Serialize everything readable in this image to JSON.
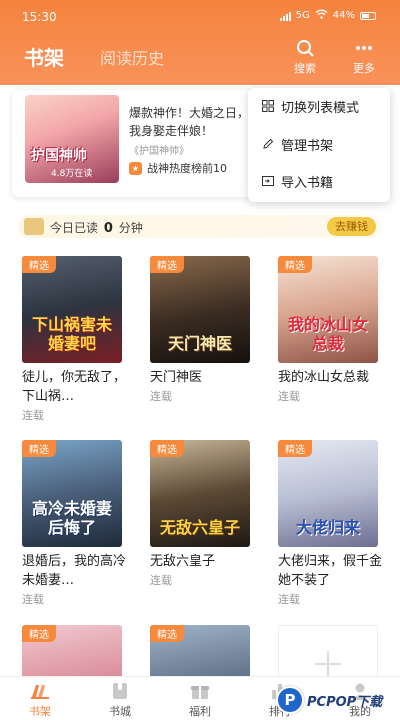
{
  "status_bar": {
    "time": "15:30",
    "network": "5G",
    "battery": "44%"
  },
  "header": {
    "tabs": [
      {
        "label": "书架"
      },
      {
        "label": "阅读历史"
      }
    ],
    "search_label": "搜索",
    "more_label": "更多"
  },
  "featured": {
    "cover_title": "护国神帅",
    "cover_readers": "4.8万在读",
    "description": "爆款神作！大婚之日，而我身娶走伴娘！",
    "book_name": "《护国神帅》",
    "rank_text": "战神热度榜前10"
  },
  "menu": {
    "items": [
      {
        "label": "切换列表模式",
        "icon": "grid-icon"
      },
      {
        "label": "管理书架",
        "icon": "pencil-icon"
      },
      {
        "label": "导入书籍",
        "icon": "import-icon"
      }
    ]
  },
  "reading": {
    "prefix": "今日已读",
    "minutes": "0",
    "suffix": "分钟",
    "earn_label": "去赚钱"
  },
  "books": [
    {
      "tag": "精选",
      "cover_title": "下山祸害未婚妻吧",
      "title": "徒儿，你无敌了，下山祸…",
      "status": "连载"
    },
    {
      "tag": "精选",
      "cover_title": "天门神医",
      "title": "天门神医",
      "status": "连载"
    },
    {
      "tag": "精选",
      "cover_title": "我的冰山女总裁",
      "title": "我的冰山女总裁",
      "status": "连载"
    },
    {
      "tag": "精选",
      "cover_title": "高冷未婚妻后悔了",
      "title": "退婚后，我的高冷未婚妻…",
      "status": "连载"
    },
    {
      "tag": "精选",
      "cover_title": "无敌六皇子",
      "title": "无敌六皇子",
      "status": "连载"
    },
    {
      "tag": "精选",
      "cover_title": "大佬归来",
      "title": "大佬归来，假千金她不装了",
      "status": "连载"
    },
    {
      "tag": "精选",
      "cover_title": ""
    },
    {
      "tag": "精选",
      "cover_title": ""
    }
  ],
  "bottom_nav": [
    {
      "label": "书架",
      "icon": "bookshelf-icon",
      "active": true
    },
    {
      "label": "书城",
      "icon": "book-icon"
    },
    {
      "label": "福利",
      "icon": "gift-icon"
    },
    {
      "label": "排行",
      "icon": "ranking-icon"
    },
    {
      "label": "我的",
      "icon": "profile-icon"
    }
  ],
  "watermark": {
    "text": "PCPOP下载",
    "letter": "P"
  },
  "colors": {
    "accent": "#f5833e",
    "tag": "#f58a3d",
    "earn": "#f3c94a"
  }
}
